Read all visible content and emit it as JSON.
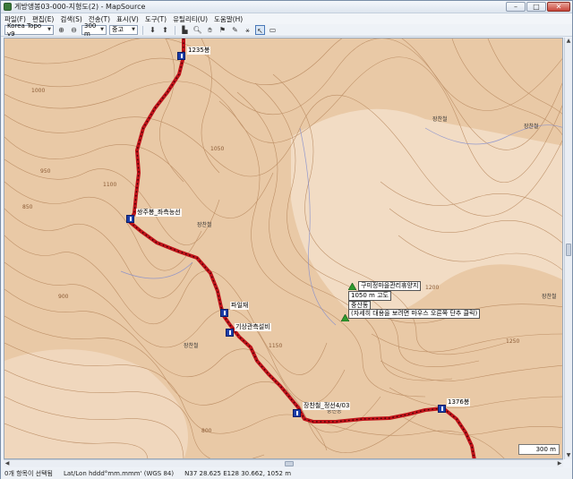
{
  "window": {
    "title": "게방앵봉03-000-지형도(2) - MapSource"
  },
  "window_controls": {
    "minimize": "–",
    "maximize": "□",
    "close": "✕"
  },
  "menu": [
    {
      "label": "파일(F)"
    },
    {
      "label": "편집(E)"
    },
    {
      "label": "검색(S)"
    },
    {
      "label": "전송(T)"
    },
    {
      "label": "표시(V)"
    },
    {
      "label": "도구(T)"
    },
    {
      "label": "유틸리티(U)"
    },
    {
      "label": "도움말(H)"
    }
  ],
  "toolbar": {
    "map_product": "Korea Topo v9",
    "zoom_scale": "300 m",
    "detail_level": "중고"
  },
  "map": {
    "waypoints": [
      {
        "label": "1235봉"
      },
      {
        "label": "쌍주봉_좌측능선"
      },
      {
        "label": "파일재"
      },
      {
        "label": "기상관측설비"
      },
      {
        "label": "장찬철_정선4/03"
      },
      {
        "label": "1376봉"
      }
    ],
    "info": {
      "place": "구미정마을관리휴양지",
      "elevation": "1050 m 고도",
      "name": "중산동",
      "note": "(자세히 대용을 보려면 마우스 오른쪽 단추 클릭)"
    },
    "contour_labels": [
      "1000",
      "950",
      "900",
      "1050",
      "1100",
      "1150",
      "1200",
      "1250",
      "850",
      "800"
    ],
    "area_labels": [
      "장찬철",
      "장찬철",
      "장찬철",
      "장찬철",
      "중진동",
      "장찬철"
    ],
    "scale": "300 m"
  },
  "status": {
    "selection": "0개 항목이 선택됨",
    "format": "Lat/Lon hddd°mm.mmm' (WGS 84)",
    "position": "N37 28.625 E128 30.662, 1052 m"
  },
  "colors": {
    "track": "#c0131a",
    "map_bg": "#e9c9a6",
    "contour": "#b6865c",
    "waypoint": "#1d3ea8"
  }
}
